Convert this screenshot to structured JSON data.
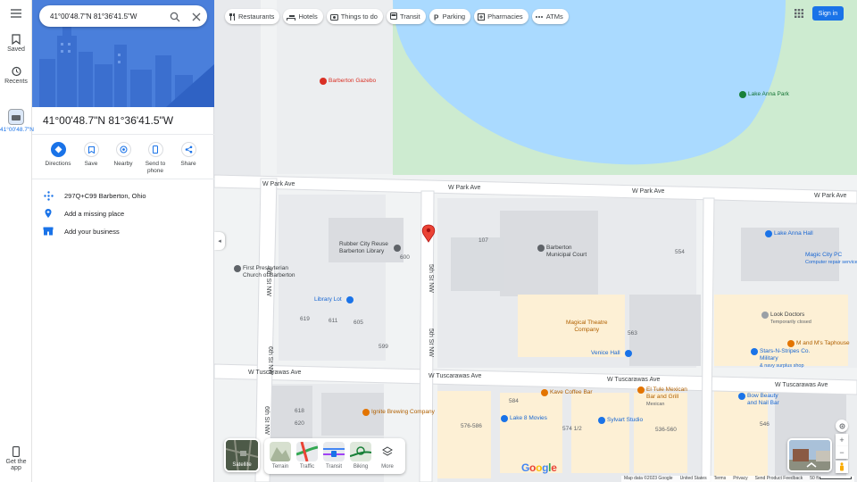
{
  "rail": {
    "saved": "Saved",
    "recents": "Recents",
    "recent_place": "41°00'48.7\"N",
    "get_app": "Get the app"
  },
  "search": {
    "value": "41°00'48.7\"N 81°36'41.5\"W"
  },
  "place": {
    "title": "41°00'48.7\"N 81°36'41.5\"W",
    "actions": {
      "directions": "Directions",
      "save": "Save",
      "nearby": "Nearby",
      "send_to_phone": "Send to phone",
      "share": "Share"
    },
    "plus_code": "297Q+C99 Barberton, Ohio",
    "add_missing": "Add a missing place",
    "add_business": "Add your business"
  },
  "chips": {
    "restaurants": "Restaurants",
    "hotels": "Hotels",
    "things_to_do": "Things to do",
    "transit": "Transit",
    "parking": "Parking",
    "pharmacies": "Pharmacies",
    "atms": "ATMs"
  },
  "header": {
    "sign_in": "Sign in"
  },
  "map": {
    "streets": {
      "w_park_1": "W Park Ave",
      "w_park_2": "W Park Ave",
      "w_park_3": "W Park Ave",
      "w_park_4": "W Park Ave",
      "w_tusc_1": "W Tuscarawas Ave",
      "w_tusc_2": "W Tuscarawas Ave",
      "w_tusc_3": "W Tuscarawas Ave",
      "w_tusc_4": "W Tuscarawas Ave",
      "w_tusc_5": "W Tuscarawas Ave",
      "sixth_st_1": "6th St NW",
      "sixth_st_2": "6th St NW",
      "sixth_st_3": "6th St NW",
      "fifth_st_1": "5th St NW",
      "fifth_st_2": "5th St NW"
    },
    "pois": {
      "gazebo": "Barberton Gazebo",
      "lake_anna_park": "Lake Anna Park",
      "rubber_city": "Rubber City Reuse",
      "rubber_city_2": "Barberton Library",
      "court_1": "Barberton",
      "court_2": "Municipal Court",
      "lake_anna_hall": "Lake Anna Hall",
      "magic_city": "Magic City PC",
      "magic_city_sub": "Computer repair service",
      "presbyterian_1": "First Presbyterian",
      "presbyterian_2": "Church of Barberton",
      "library_lot": "Library Lot",
      "magical_theatre_1": "Magical Theatre",
      "magical_theatre_2": "Company",
      "look_doctors": "Look Doctors",
      "look_doctors_sub": "Temporarily closed",
      "m_and_ms": "M and M's Taphouse",
      "stars_1": "Stars-N-Stripes Co.",
      "stars_2": "Military",
      "stars_sub": "& navy surplus shop",
      "venice_hall": "Venice Hall",
      "kave": "Kave Coffee Bar",
      "el_tule_1": "El Tule Mexican",
      "el_tule_2": "Bar and Grill",
      "el_tule_sub": "Mexican",
      "bow_beauty_1": "Bow Beauty",
      "bow_beauty_2": "and Nail Bar",
      "ignite": "Ignite Brewing Company",
      "lake_8": "Lake 8 Movies",
      "sylvart": "Sylvart Studio"
    },
    "numbers": {
      "n107": "107",
      "n600": "600",
      "n554": "554",
      "n619": "619",
      "n611": "611",
      "n605": "605",
      "n599": "599",
      "n563": "563",
      "n584": "584",
      "n618": "618",
      "n620": "620",
      "n576": "576-586",
      "n574": "574 1/2",
      "n536": "536-560",
      "n546": "546"
    }
  },
  "layers": {
    "satellite": "Satellite",
    "terrain": "Terrain",
    "traffic": "Traffic",
    "transit": "Transit",
    "biking": "Biking",
    "more": "More"
  },
  "google_logo": "Google",
  "footer": {
    "map_data": "Map data ©2023 Google",
    "country": "United States",
    "terms": "Terms",
    "privacy": "Privacy",
    "feedback": "Send Product Feedback",
    "scale": "50 ft"
  },
  "colors": {
    "accent": "#1a73e8",
    "water": "#aadaff",
    "park": "#c8e6c9",
    "road": "#ffffff",
    "block": "#e8eaed",
    "pin": "#ea4335"
  }
}
